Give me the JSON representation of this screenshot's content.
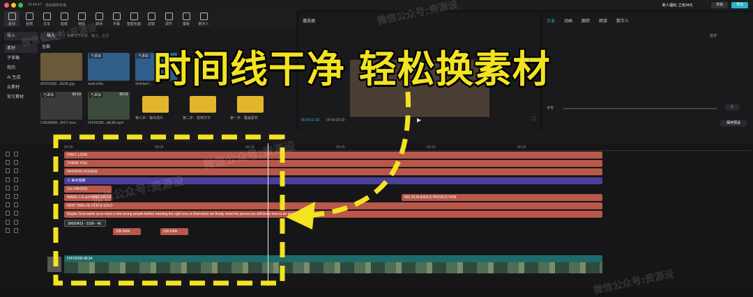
{
  "titlebar": {
    "time": "16:44:47",
    "autosave": "自动保存本地",
    "reward": "新人福利, 立省34元",
    "export": "导出",
    "share": "草稿"
  },
  "toolbar": {
    "items": [
      "素材",
      "音频",
      "文本",
      "贴纸",
      "特效",
      "转场",
      "字幕",
      "智能包装",
      "滤镜",
      "调节",
      "模板",
      "数字人"
    ]
  },
  "left": {
    "import": "导入",
    "search_placeholder": "搜索文件名称、备注、台词",
    "all": "全部",
    "nav": [
      "素材",
      "子草稿",
      "我的",
      "AI 生成",
      "云素材",
      "官方素材"
    ],
    "media": [
      {
        "label": "AF20232E...EE0E.jpg",
        "badge": ""
      },
      {
        "label": "sunk.m4a",
        "badge": "已添加"
      },
      {
        "label": "3e4cfae7...",
        "badge": "已添加"
      },
      {
        "label": "C45986BA...0FF7.mov",
        "badge": "已添加",
        "dur": "00:10"
      },
      {
        "label": "F6F65286...AE3B.mp4",
        "badge": "已添加",
        "dur": "00:31"
      },
      {
        "label": "第三步：输出成片",
        "badge": ""
      },
      {
        "label": "第二步：替换文字",
        "badge": ""
      },
      {
        "label": "第一步：覆盖素材",
        "badge": ""
      }
    ]
  },
  "player": {
    "title": "播放器",
    "current": "00:00:11:18",
    "total": "00:00:30:00"
  },
  "right": {
    "tabs": [
      "文本",
      "动画",
      "跟踪",
      "朗读",
      "数字人"
    ],
    "section": "花字",
    "spacing_label": "字号",
    "spacing_value": "2",
    "save_preset": "保存预设"
  },
  "timeline": {
    "ruler": [
      "00:00",
      "00:05",
      "00:10",
      "00:15",
      "00:20",
      "00:25"
    ],
    "tracks": [
      {
        "text": "FIRST LOOK",
        "color": "#b8574a"
      },
      {
        "text": "THANK YOU",
        "color": "#b8574a"
      },
      {
        "text": "FASHION SCENSE",
        "color": "#b8574a"
      },
      {
        "text": "⊙ 美术观察",
        "color": "#4a3f9a"
      },
      {
        "text": "Oct 24th2031",
        "color": "#b8574a"
      },
      {
        "text": "WANG LIJI &ZHANG XIN DI",
        "text2": "NIS FILM &SOLD PRODUCTION",
        "color": "#b8574a"
      },
      {
        "text": "NEW TWELVE FILM & SOLD",
        "color": "#b8574a"
      },
      {
        "text": "Maybe God wants us to meet a few wrong people before meeting the right one,so that when we finally meet the person,we will know how to be grateful",
        "color": "#b8574a"
      },
      {
        "text": "30000433 - 2108 - 40",
        "color": "#2c2c30"
      },
      {
        "text": "XIN DAN",
        "text2": "XIN DAN",
        "color": "#b8574a"
      }
    ],
    "video_clip": "F6F65286-8E3A"
  },
  "overlay": {
    "headline": "时间线干净 轻松换素材"
  },
  "watermarks": [
    "微信公众号:资源设",
    "微信公众号:资源设",
    "微信公众号:资源设",
    "微信公众号:资源设",
    "微信公众号:资源设"
  ],
  "colors": {
    "accent": "#f3e321",
    "track_red": "#b8574a",
    "track_purple": "#4a3f9a",
    "teal": "#1e6b6b"
  }
}
